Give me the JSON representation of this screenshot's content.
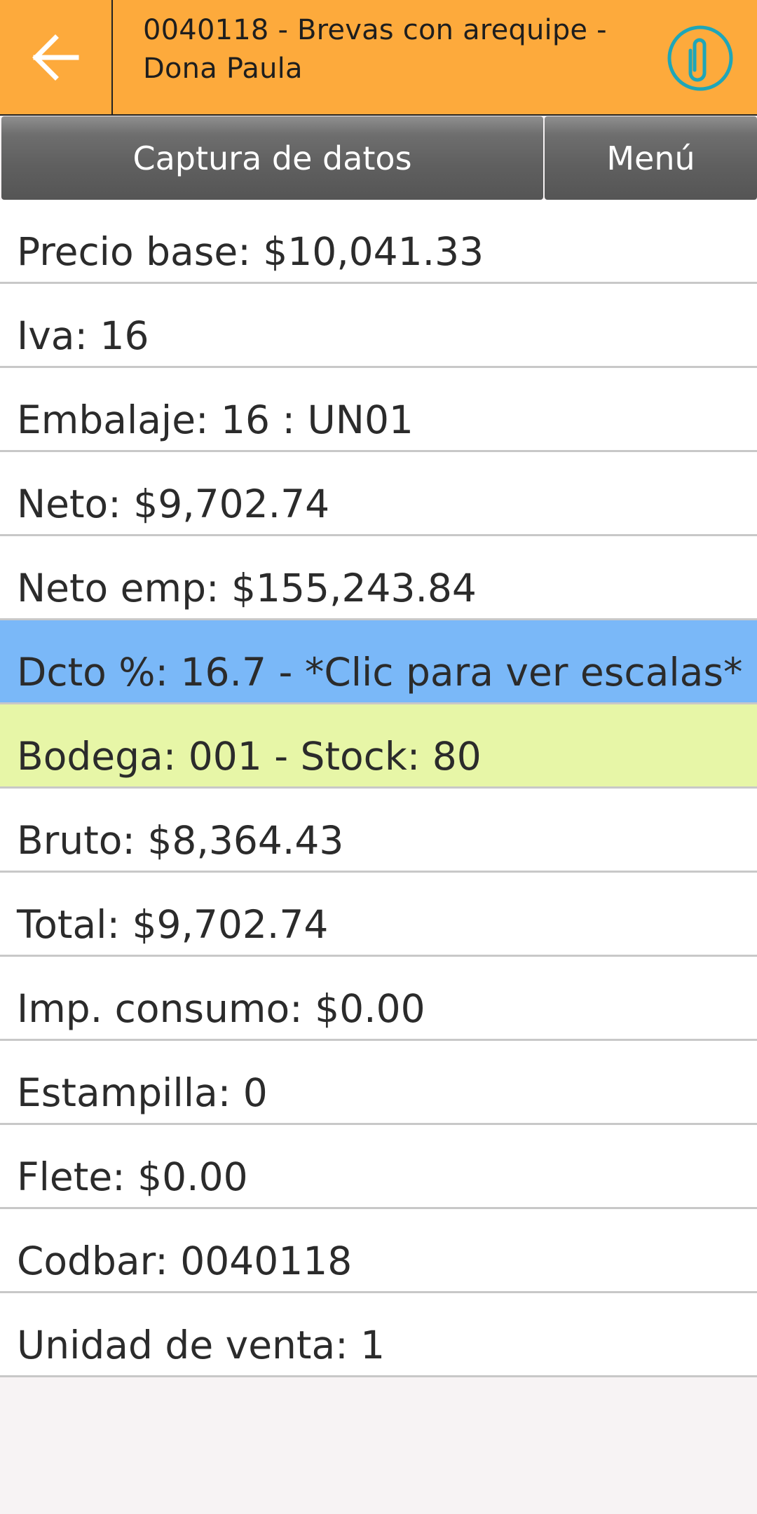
{
  "header": {
    "title": "0040118 - Brevas con arequipe - Dona Paula",
    "back_icon": "back-arrow-icon",
    "attach_icon": "paperclip-icon",
    "colors": {
      "bar": "#fdaa3c",
      "attach": "#1fa6b8"
    }
  },
  "tabs": [
    {
      "label": "Captura de datos"
    },
    {
      "label": "Menú"
    }
  ],
  "rows": [
    {
      "text": "Precio base: $10,041.33"
    },
    {
      "text": "Iva: 16"
    },
    {
      "text": "Embalaje: 16 : UN01"
    },
    {
      "text": "Neto: $9,702.74"
    },
    {
      "text": "Neto emp: $155,243.84"
    },
    {
      "text": "Dcto %: 16.7 - *Clic para ver escalas*",
      "highlight": "#7ab8f8"
    },
    {
      "text": "Bodega: 001 - Stock: 80",
      "highlight": "#e7f6a7"
    },
    {
      "text": "Bruto: $8,364.43"
    },
    {
      "text": "Total: $9,702.74"
    },
    {
      "text": "Imp. consumo: $0.00"
    },
    {
      "text": "Estampilla: 0"
    },
    {
      "text": "Flete: $0.00"
    },
    {
      "text": "Codbar: 0040118"
    },
    {
      "text": "Unidad de venta: 1"
    }
  ]
}
